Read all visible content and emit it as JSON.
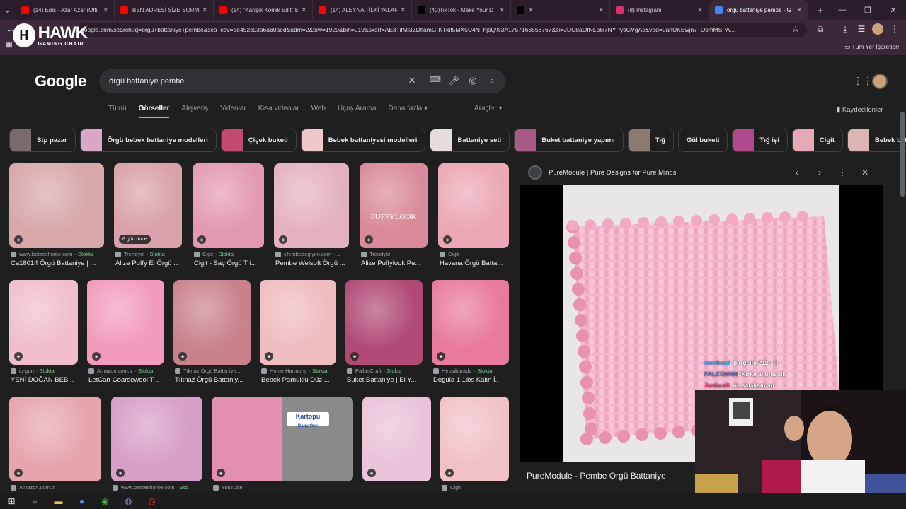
{
  "browser": {
    "tabs": [
      {
        "title": "(14) Edis - Azar Azar (Offi",
        "color": "#ff0000"
      },
      {
        "title": "BEN ADRESİ SİZE SORMA",
        "color": "#ff0000"
      },
      {
        "title": "(14) \"Karışık Komik Edit\" E",
        "color": "#ff0000"
      },
      {
        "title": "(14) ALEYNA TİLKİ YALAN",
        "color": "#ff0000"
      },
      {
        "title": "(40)TikTok - Make Your D",
        "color": "#000000"
      },
      {
        "title": "X",
        "color": "#000000"
      },
      {
        "title": "(8) Instagram",
        "color": "#e1306c"
      },
      {
        "title": "örgü battaniye pembe - G",
        "color": "#4285f4"
      }
    ],
    "url": "google.com/search?q=örgü+battaniye+pembe&sca_esv=de452c03a6a60aed&udm=2&biw=1920&bih=919&sxsrf=AE3TifMl3ZDflamG-KTkif5MX5U4N_hjsQ%3A1757163556767&ei=JDC8aOfNLp6l7NYPysGVgAc&ved=0ahUKEwjn7_OsmMSPA...",
    "bookmarks_all": "Tüm Yer İşaretleri"
  },
  "overlay_logo": {
    "mark": "H",
    "name": "HAWK",
    "tagline": "GAMING CHAIR"
  },
  "google": {
    "logo": "Google",
    "query": "örgü battaniye pembe",
    "tabs": [
      "Tümü",
      "Görseller",
      "Alışveriş",
      "Videolar",
      "Kısa videolar",
      "Web",
      "Uçuş Arama",
      "Daha fazla ▾"
    ],
    "tools": "Araçlar ▾",
    "saved": "Kaydedilenler",
    "chips": [
      {
        "label": "Stp pazar",
        "color": "#7a6a6a"
      },
      {
        "label": "Örgü bebek battaniye modelleri",
        "color": "#d9a8c8"
      },
      {
        "label": "Çiçek buketi",
        "color": "#c24a6e"
      },
      {
        "label": "Bebek battaniyesi modelleri",
        "color": "#f0c8cc"
      },
      {
        "label": "Battaniye seti",
        "color": "#e6dcdc"
      },
      {
        "label": "Buket battaniye yapımı",
        "color": "#a85a84"
      },
      {
        "label": "Tığ",
        "color": "#8a7a72"
      },
      {
        "label": "Gül buketi",
        "color": ""
      },
      {
        "label": "Tığ işi",
        "color": "#b04a8c"
      },
      {
        "label": "Cigit",
        "color": "#e8a9b6"
      },
      {
        "label": "Bebek battan",
        "color": "#dcb4b4"
      }
    ],
    "results": [
      {
        "source": "www.betireshome.com",
        "stock": "· Stokta",
        "caption": "Ca18014 Örgü Battaniye | ...",
        "color": "#d7a7a9",
        "badge": ""
      },
      {
        "source": "Trendyol",
        "stock": "· Stokta",
        "caption": "Alize Puffy El Örgü ...",
        "color": "#d9a1a9",
        "badge": "6 gün önce"
      },
      {
        "source": "Cigit",
        "stock": "· Stokta",
        "caption": "Cigit - Saç Örgü Tri...",
        "color": "#e39ab0",
        "badge": ""
      },
      {
        "source": "efembebegiyim.com",
        "stock": "· ...",
        "caption": "Pembe Welsoft Örgü ...",
        "color": "#e4b2bf",
        "badge": ""
      },
      {
        "source": "Trendyol",
        "stock": "",
        "caption": "Alize Puffylook Pe...",
        "color": "#d98a9a",
        "badge": ""
      },
      {
        "source": "Cigit",
        "stock": "",
        "caption": "Havana Örgü Batta...",
        "color": "#eba7b4",
        "badge": ""
      },
      {
        "source": "ip-gon",
        "stock": "· Stokta",
        "caption": "YENİ DOĞAN BEB...",
        "color": "#f0bfc9",
        "badge": ""
      },
      {
        "source": "Amazon.com.tr",
        "stock": "· Stokta",
        "caption": "LetCart Coarsewool T...",
        "color": "#f29bbd",
        "badge": ""
      },
      {
        "source": "Tıknaz Örgü Battaniye...",
        "stock": "",
        "caption": "Tıknaz Örgü Battaniy...",
        "color": "#c9828c",
        "badge": ""
      },
      {
        "source": "Home Harmony",
        "stock": "· Stokta",
        "caption": "Bebek Pamuklu Düz ...",
        "color": "#efbcc0",
        "badge": ""
      },
      {
        "source": "PallasCraft",
        "stock": "· Stokta",
        "caption": "Buket Battaniye | El Y...",
        "color": "#b04a74",
        "badge": ""
      },
      {
        "source": "Hepsiburada",
        "stock": "· Stokta",
        "caption": "Dogula 1.1lbs Kalın İ...",
        "color": "#e87a9a",
        "badge": ""
      },
      {
        "source": "Amazon.com.tr",
        "stock": "",
        "caption": "",
        "color": "#e6a5ad",
        "badge": ""
      },
      {
        "source": "www.betireshome.com",
        "stock": "· Sto",
        "caption": "",
        "color": "#d79ec6",
        "badge": ""
      },
      {
        "source": "YouTube",
        "stock": "",
        "caption": "",
        "color": "#e28fb2",
        "badge": ""
      },
      {
        "source": "",
        "stock": "",
        "caption": "",
        "color": "#e9c3d7",
        "badge": ""
      },
      {
        "source": "Cigit",
        "stock": "",
        "caption": "",
        "color": "#f0c2c8",
        "badge": ""
      }
    ],
    "tile_labels": {
      "puffylook": "PUFFYLOOK",
      "kartopu": "Kartopu",
      "kartopu_sub": "Baby One"
    }
  },
  "panel": {
    "site": "PureModule | Pure Designs for Pure Minds",
    "caption": "PureModule - Pembe Örgü Battaniye",
    "image_color": "#f4b6cc"
  },
  "stream_chat": [
    {
      "user": "mertkocf",
      "msg": ": bargello 212 sık"
    },
    {
      "user": "FALCONNN",
      "msg": ": Kirke al onu sık"
    },
    {
      "user": "Jardarali",
      "msg": ": ne salaksın aq"
    }
  ]
}
